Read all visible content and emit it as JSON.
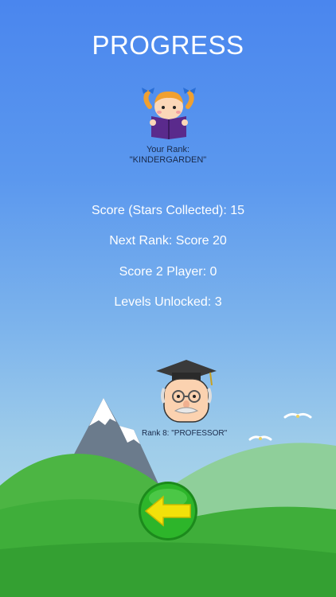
{
  "page": {
    "title": "PROGRESS"
  },
  "rank": {
    "label": "Your Rank:",
    "value": "\"KINDERGARDEN\""
  },
  "stats": [
    {
      "text": "Score (Stars Collected): 15"
    },
    {
      "text": "Next Rank: Score 20"
    },
    {
      "text": "Score 2 Player: 0"
    },
    {
      "text": "Levels Unlocked:  3"
    }
  ],
  "next_rank": {
    "label": "Rank 8: \"PROFESSOR\""
  },
  "icons": {
    "current_rank": "girl-reading-icon",
    "target_rank": "professor-icon",
    "back": "arrow-left-icon"
  },
  "colors": {
    "sky_top": "#4a86ee",
    "hill_green": "#3fae3a",
    "button_green": "#2db52a",
    "arrow_yellow": "#f2e10a"
  }
}
